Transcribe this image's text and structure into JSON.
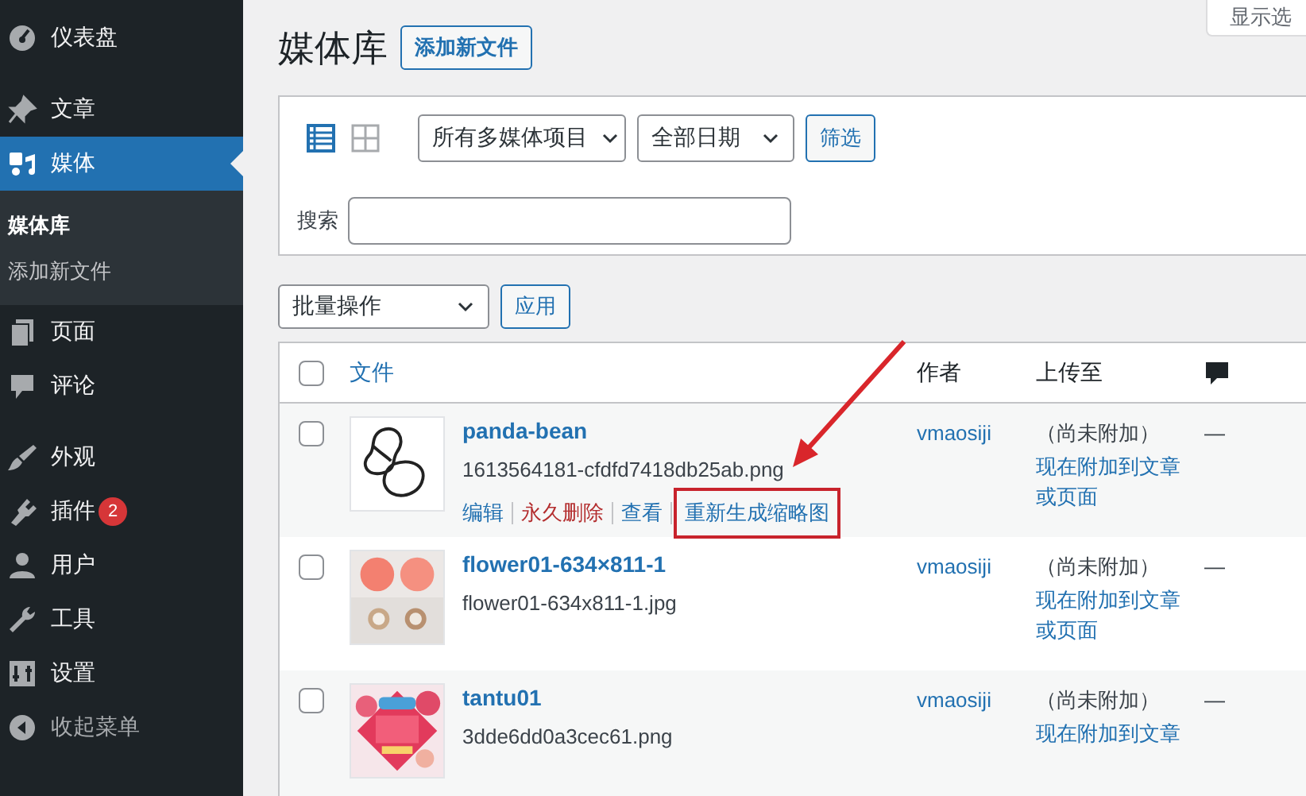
{
  "sidebar": {
    "groups": [
      [
        {
          "label": "仪表盘",
          "selected": false
        }
      ],
      [
        {
          "label": "文章",
          "selected": false
        },
        {
          "label": "媒体",
          "selected": true,
          "submenu": [
            {
              "label": "媒体库",
              "selected": true
            },
            {
              "label": "添加新文件",
              "selected": false
            }
          ]
        },
        {
          "label": "页面",
          "selected": false
        },
        {
          "label": "评论",
          "selected": false
        }
      ],
      [
        {
          "label": "外观",
          "selected": false
        },
        {
          "label": "插件",
          "selected": false,
          "badge": "2"
        },
        {
          "label": "用户",
          "selected": false
        },
        {
          "label": "工具",
          "selected": false
        },
        {
          "label": "设置",
          "selected": false
        }
      ]
    ],
    "collapse": "收起菜单"
  },
  "screen_options": "显示选",
  "page_title": "媒体库",
  "add_button": "添加新文件",
  "filters": {
    "views": [
      {
        "kind": "list",
        "selected": true
      },
      {
        "kind": "grid",
        "selected": false
      }
    ],
    "type_select": "所有多媒体项目",
    "date_select": "全部日期",
    "filter_button": "筛选",
    "search_label": "搜索"
  },
  "bulk": {
    "select": "批量操作",
    "apply": "应用"
  },
  "table": {
    "header_checked": false,
    "columns": [
      "文件",
      "作者",
      "上传至"
    ],
    "rows": [
      {
        "checked": false,
        "thumbnail": {
          "kind": "drawing"
        },
        "title": "panda-bean",
        "filename": "1613564181-cfdfd7418db25ab.png",
        "actions": [
          {
            "label": "编辑",
            "kind": "link",
            "highlighted": false
          },
          {
            "label": "永久删除",
            "kind": "delete",
            "highlighted": false
          },
          {
            "label": "查看",
            "kind": "link",
            "highlighted": false
          },
          {
            "label": "重新生成缩略图",
            "kind": "link",
            "highlighted": true
          }
        ],
        "author": "vmaosiji",
        "status": "（尚未附加）",
        "attach_link": "现在附加到文章或页面",
        "comments": "—"
      },
      {
        "checked": false,
        "title": "flower01-634×811-1",
        "filename": "flower01-634x811-1.jpg",
        "author": "vmaosiji",
        "status": "（尚未附加）",
        "attach_link": "现在附加到文章或页面",
        "comments": "—"
      },
      {
        "checked": false,
        "title": "tantu01",
        "filename": "3dde6dd0a3cec61.png",
        "author": "vmaosiji",
        "status": "（尚未附加）",
        "attach_link": "现在附加到文章",
        "comments": "—"
      }
    ]
  }
}
